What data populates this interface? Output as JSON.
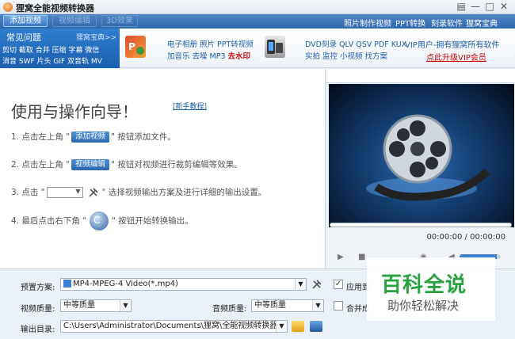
{
  "window": {
    "title": "狸窝全能视频转换器",
    "controls": [
      "▤",
      "—",
      "□",
      "✕"
    ]
  },
  "tabs": [
    {
      "label": "添加视频"
    },
    {
      "label": "视频编辑"
    },
    {
      "label": "3D效果"
    }
  ],
  "top_links": [
    "照片制作视频",
    "PPT转换",
    "刻录软件",
    "狸窝宝典"
  ],
  "promo": {
    "faq_title": "常见问题",
    "faq_more": "狸窝宝典>>",
    "faq_line1": "剪切 截取 合并 压缩 字幕 微信",
    "faq_line2": "消音 SWF 片头 GIF 双音轨 MV",
    "ad1_line1": "电子相册 照片 PPT转视频",
    "ad1_line2_a": "加音乐 去噪 MP3 ",
    "ad1_line2_b": "去水印",
    "ad2_line1": "DVD刻录 QLV QSV PDF KUX",
    "ad2_line2": "实拍 监控 小视频 找方案",
    "vip_line1": "VIP用户-拥有狸窝所有软件",
    "vip_line2": "点此升级VIP会员"
  },
  "guide": {
    "title": "使用与操作向导！",
    "tutorial_link": "[新手教程]",
    "step1_prefix": "1. 点击左上角 \"",
    "step1_btn": "添加视频",
    "step1_suffix": "\" 按钮添加文件。",
    "step2_prefix": "2. 点击左上角 \"",
    "step2_btn": "视频编辑",
    "step2_suffix": "\" 按钮对视频进行裁剪编辑等效果。",
    "step3_prefix": "3. 点击 \"",
    "step3_suffix": "\" 选择视频输出方案及进行详细的输出设置。",
    "step4_prefix": "4. 最后点击右下角 \"",
    "step4_suffix": "\" 按钮开始转换输出。"
  },
  "player": {
    "timecode": "00:00:00 / 00:00:00",
    "volume": 0.9
  },
  "settings": {
    "preset_label": "预置方案:",
    "preset_value": "MP4-MPEG-4 Video(*.mp4)",
    "video_quality_label": "视频质量:",
    "video_quality_value": "中等质量",
    "audio_quality_label": "音频质量:",
    "audio_quality_value": "中等质量",
    "output_dir_label": "输出目录:",
    "output_dir_value": "C:\\Users\\Administrator\\Documents\\狸窝\\全能视频转换器",
    "apply_label": "应用到",
    "merge_label": "合并成"
  },
  "watermark": {
    "title": "百科全说",
    "subtitle": "助你轻松解决"
  },
  "colors": {
    "accent": "#2f68ad",
    "promo_red": "#c81010",
    "watermark_green": "#27a23e"
  }
}
